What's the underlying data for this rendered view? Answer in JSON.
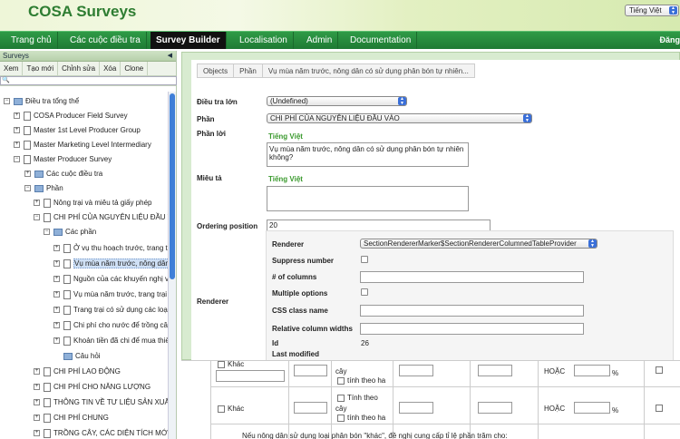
{
  "app": {
    "title": "COSA Surveys",
    "language": "Tiếng Việt"
  },
  "nav": {
    "items": [
      "Trang chủ",
      "Các cuộc điều tra",
      "Survey Builder",
      "Localisation",
      "Admin",
      "Documentation"
    ],
    "active": "Survey Builder",
    "user": "Đăng"
  },
  "sidebar": {
    "title": "Surveys",
    "toolbar": [
      "Xem",
      "Tạo mới",
      "Chỉnh sửa",
      "Xóa",
      "Clone"
    ],
    "search_placeholder": "",
    "tree": [
      "Điều tra tổng thể",
      "COSA Producer Field Survey",
      "Master 1st Level Producer Group",
      "Master Marketing Level Intermediary",
      "Master Producer Survey",
      "Các cuộc điều tra",
      "Phần",
      "Nông trại và miêu tả giấy phép",
      "CHI PHÍ CỦA NGUYÊN LIỆU ĐẦU VÀ",
      "Các phần",
      "Ở vụ thu hoạch trước, trang trại",
      "Vụ mùa năm trước, nông dân có",
      "Nguồn của các khuyến nghị về",
      "Vụ mùa năm trước, trang trại có",
      "Trang trại có sử dụng các loại",
      "Chi phí cho nước để trồng cây",
      "Khoản tiền đã chi để mua thiết",
      "Câu hỏi",
      "CHI PHÍ LAO ĐỘNG",
      "CHI PHÍ CHO NĂNG LƯỢNG",
      "THÔNG TIN VỀ TƯ LIỆU SẢN XUẤT",
      "CHI PHÍ CHUNG",
      "TRỒNG CÂY, CÁC DIỆN TÍCH MỚI"
    ]
  },
  "editor": {
    "breadcrumb": [
      "Objects",
      "Phần",
      "Vụ mùa năm trước, nông dân có sử dụng phân bón tự nhiên..."
    ],
    "survey_label": "Điều tra lớn",
    "survey_value": "(Undefined)",
    "section_label": "Phần",
    "section_value": "CHI PHÍ CỦA NGUYÊN LIỆU ĐẦU VÀO",
    "text_label": "Phần lời",
    "text_lang": "Tiếng Việt",
    "text_value": "Vụ mùa năm trước, nông dân có sử dụng phân bón tự nhiên không?",
    "desc_label": "Miêu tả",
    "desc_lang": "Tiếng Việt",
    "desc_value": "",
    "ordering_label": "Ordering position",
    "ordering_value": "20",
    "renderer_label": "Renderer",
    "renderer": {
      "renderer_label": "Renderer",
      "renderer_value": "SectionRendererMarker$SectionRendererColumnedTableProvider",
      "suppress_label": "Suppress number",
      "columns_label": "# of columns",
      "multiple_label": "Multiple options",
      "css_label": "CSS class name",
      "relwidth_label": "Relative column widths",
      "id_label": "Id",
      "id_value": "26",
      "modified_label": "Last modified"
    }
  },
  "lower": {
    "other1": "Khác",
    "other2": "Khác",
    "tree_label": "cây",
    "calc_label": "tính theo ha",
    "price_by": "Tính theo",
    "or_label": "HOẶC",
    "percent": "%",
    "footnote": "Nếu nông dân sử dụng loại phân bón \"khác\", đề nghị cung cấp tỉ lệ phần trăm cho:"
  }
}
